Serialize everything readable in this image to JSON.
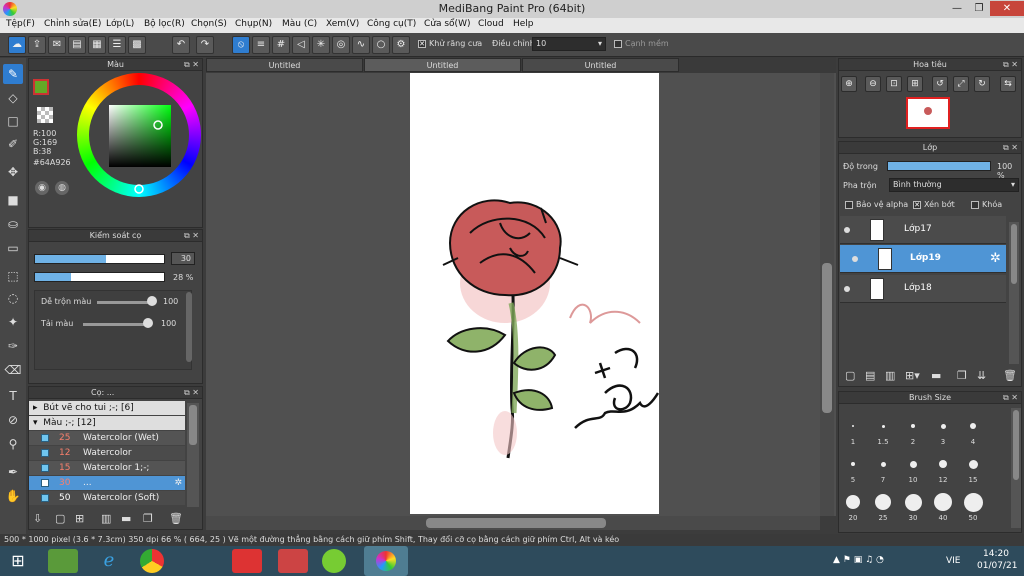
{
  "window": {
    "title": "MediBang Paint Pro (64bit)"
  },
  "menu": [
    "Tệp(F)",
    "Chỉnh sửa(E)",
    "Lớp(L)",
    "Bộ lọc(R)",
    "Chọn(S)",
    "Chụp(N)",
    "Màu (C)",
    "Xem(V)",
    "Công cụ(T)",
    "Cửa sổ(W)",
    "Cloud",
    "Help"
  ],
  "toolbar": {
    "antialias_label": "Khử răng cưa",
    "correction_label": "Điều chỉnh",
    "correction_value": "10",
    "edge_label": "Cạnh mềm"
  },
  "color_panel": {
    "title": "Màu",
    "r": "R:100",
    "g": "G:169",
    "b": "B:38",
    "hex": "#64A926",
    "color_hex": "#64A926"
  },
  "brush_control": {
    "title": "Kiểm soát cọ",
    "size_value": "30",
    "opacity_value": "28 %",
    "size_fraction": 0.55,
    "opacity_fraction": 0.28,
    "blend_label": "Dễ trộn màu",
    "blend_value": "100",
    "amount_label": "Tải màu",
    "amount_value": "100"
  },
  "brush_panel": {
    "title": "Cọ: ...",
    "groups": [
      {
        "label": "Bút vẽ cho tui ;-; [6]"
      },
      {
        "label": "Màu ;-; [12]"
      }
    ],
    "items": [
      {
        "size": "25",
        "name": "Watercolor (Wet)"
      },
      {
        "size": "12",
        "name": "Watercolor"
      },
      {
        "size": "15",
        "name": "Watercolor 1;-;"
      },
      {
        "size": "30",
        "name": "..."
      },
      {
        "size": "50",
        "name": "Watercolor (Soft)"
      }
    ]
  },
  "tabs": [
    "Untitled",
    "Untitled",
    "Untitled"
  ],
  "navigator": {
    "title": "Hoa tiêu"
  },
  "layer_panel": {
    "title": "Lớp",
    "opacity_label": "Độ trong",
    "opacity_value": "100 %",
    "blend_label": "Pha trộn",
    "blend_value": "Bình thường",
    "protect_alpha": "Bảo vệ alpha",
    "clipping": "Xén bớt",
    "lock": "Khóa",
    "layers": [
      {
        "name": "Lớp17"
      },
      {
        "name": "Lớp19"
      },
      {
        "name": "Lớp18"
      }
    ]
  },
  "brush_size": {
    "title": "Brush Size",
    "labels": [
      "1",
      "1.5",
      "2",
      "3",
      "4",
      "5",
      "7",
      "10",
      "12",
      "15",
      "20",
      "25",
      "30",
      "40",
      "50"
    ]
  },
  "status": {
    "text": "500 * 1000 pixel   (3.6 * 7.3cm)   350 dpi   66 %   ( 664, 25 )   Vẽ một đường thẳng bằng cách giữ phím Shift, Thay đổi cỡ cọ bằng cách giữ phím Ctrl, Alt và kéo"
  },
  "taskbar": {
    "lang": "VIE",
    "time": "14:20",
    "date": "01/07/21"
  },
  "colors": {
    "accent": "#2f7dd0",
    "selected_layer": "#4f95d5",
    "brush_item": "#6fc6f0"
  }
}
